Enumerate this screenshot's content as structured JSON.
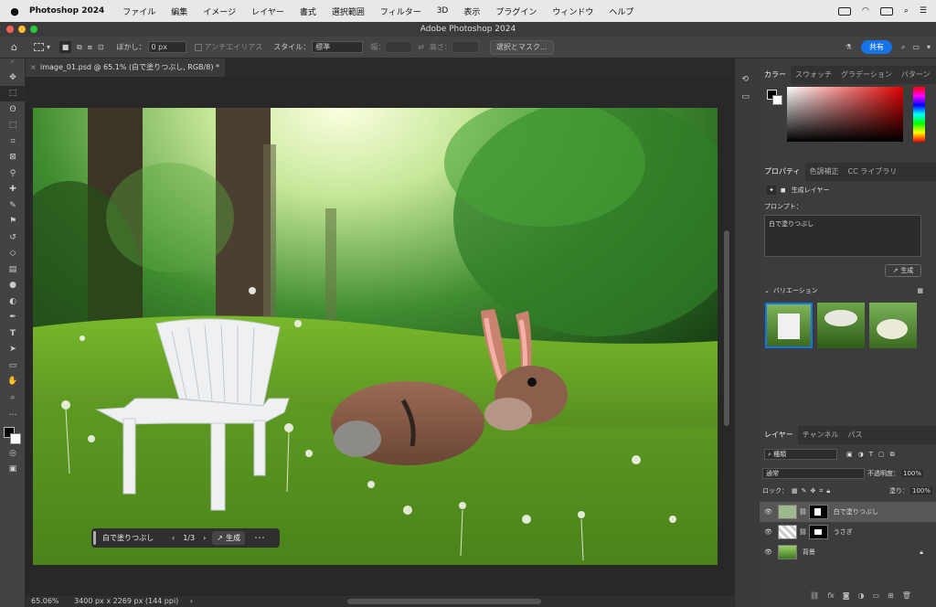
{
  "menubar": {
    "app_name": "Photoshop 2024",
    "items": [
      "ファイル",
      "編集",
      "イメージ",
      "レイヤー",
      "書式",
      "選択範囲",
      "フィルター",
      "3D",
      "表示",
      "プラグイン",
      "ウィンドウ",
      "ヘルプ"
    ]
  },
  "window": {
    "title": "Adobe Photoshop 2024"
  },
  "options": {
    "blur_label": "ぼかし：",
    "blur_value": "0 px",
    "antialias_label": "アンチエイリアス",
    "style_label": "スタイル：",
    "style_value": "標準",
    "width_label": "幅：",
    "height_label": "高さ：",
    "select_mask_label": "選択とマスク...",
    "share_label": "共有"
  },
  "document": {
    "tab_label": "image_01.psd @ 65.1% (白で塗りつぶし, RGB/8) *"
  },
  "generative_bar": {
    "prompt": "白で塗りつぶし",
    "counter": "1/3",
    "generate_label": "生成",
    "more_label": "･･･"
  },
  "status": {
    "zoom": "65.06%",
    "info": "3400 px x 2269 px (144 ppi)"
  },
  "color_panel": {
    "tabs": [
      "カラー",
      "スウォッチ",
      "グラデーション",
      "パターン"
    ]
  },
  "properties_panel": {
    "tabs": [
      "プロパティ",
      "色調補正",
      "CC ライブラリ"
    ],
    "layer_type": "生成レイヤー",
    "prompt_label": "プロンプト：",
    "prompt_value": "白で塗りつぶし",
    "generate_label": "生成",
    "variations_label": "バリエーション"
  },
  "layers_panel": {
    "tabs": [
      "レイヤー",
      "チャンネル",
      "パス"
    ],
    "filter_label": "種類",
    "blend_mode": "通常",
    "opacity_label": "不透明度：",
    "opacity_value": "100%",
    "lock_label": "ロック：",
    "fill_label": "塗り：",
    "fill_value": "100%",
    "layers": [
      {
        "name": "白で塗りつぶし"
      },
      {
        "name": "うさぎ"
      },
      {
        "name": "背景"
      }
    ]
  },
  "colors": {
    "accent": "#1473e6"
  }
}
